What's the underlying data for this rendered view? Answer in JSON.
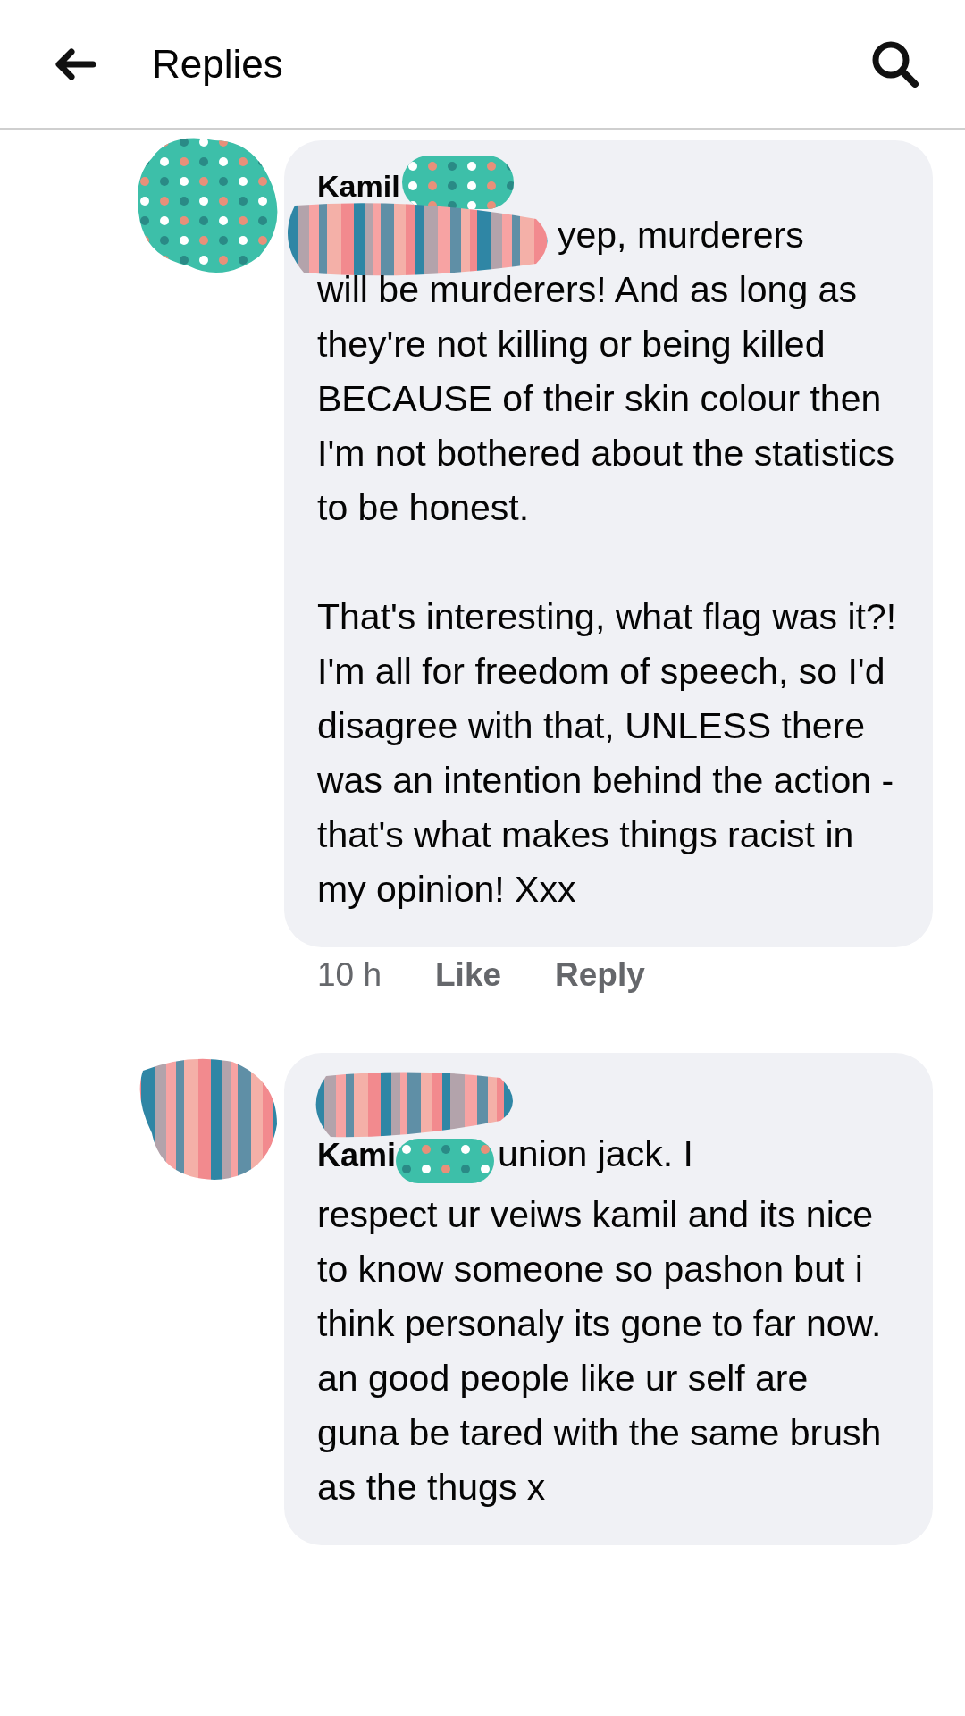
{
  "header": {
    "title": "Replies"
  },
  "comments": [
    {
      "kind": "name-above",
      "author": "Kamil",
      "lead": "yep, murderers",
      "paragraphs": [
        "will be murderers! And as long as they're not killing or being killed BECAUSE of their skin colour then I'm not bothered about the statistics to be honest.",
        "That's interesting, what flag was it?!\nI'm all for freedom of speech, so I'd disagree with that, UNLESS there was an intention behind the action - that's what makes things racist in my opinion! Xxx"
      ],
      "meta": {
        "time": "10 h",
        "like": "Like",
        "reply": "Reply"
      }
    },
    {
      "kind": "name-inline",
      "author": "Kami",
      "lead": "union jack. I",
      "paragraphs": [
        "respect ur veiws kamil and its nice to know someone so pashon but i think personaly its gone to far now. an good people like ur self are guna be tared with the same brush as the thugs x"
      ]
    }
  ]
}
